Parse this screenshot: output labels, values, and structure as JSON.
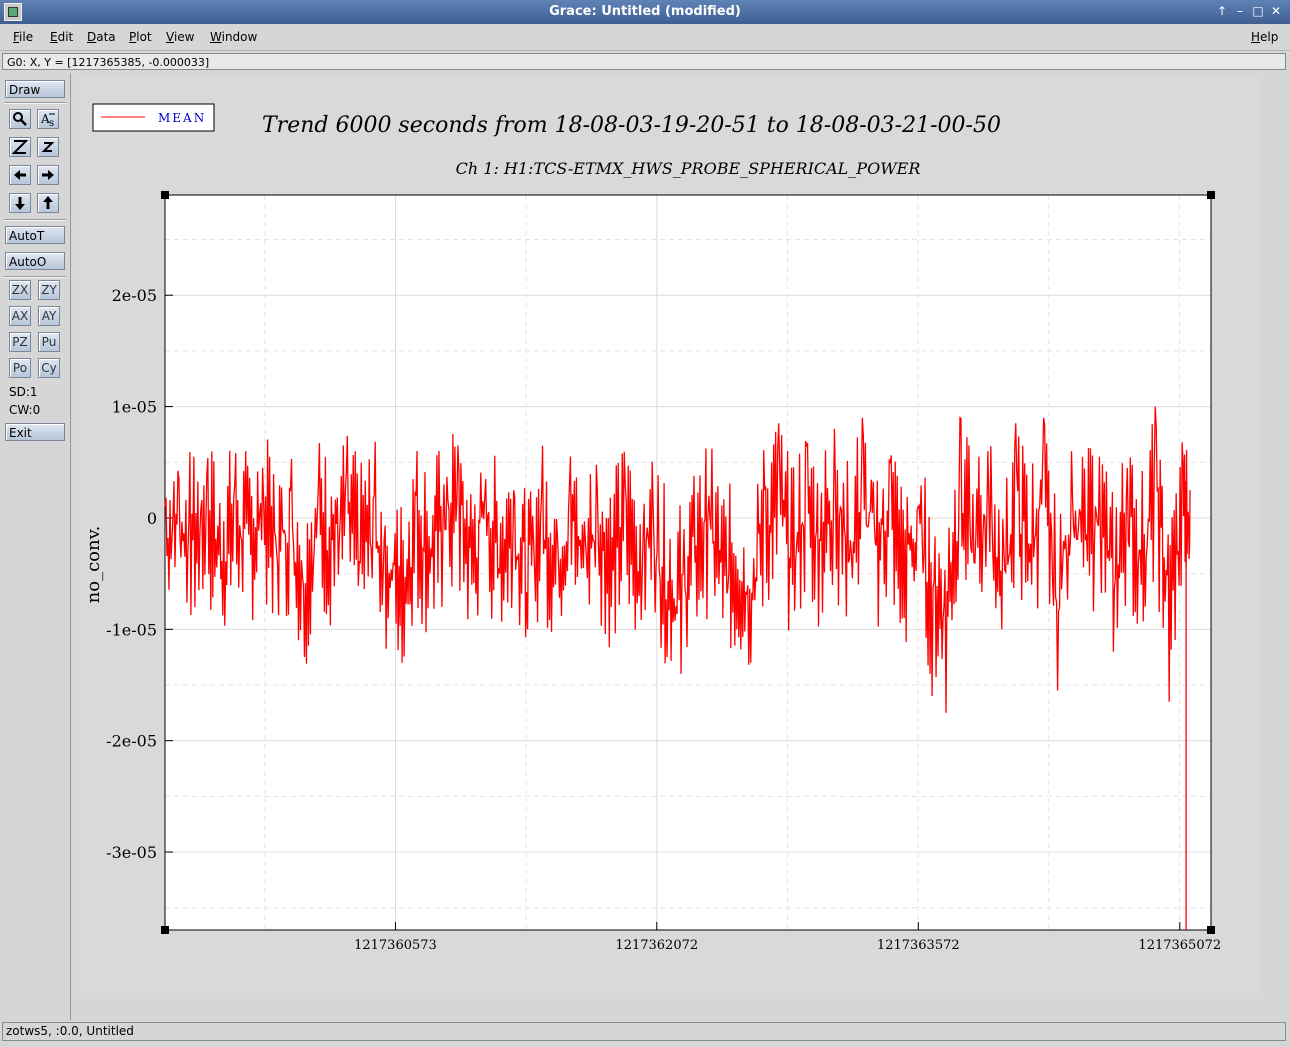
{
  "window": {
    "title": "Grace: Untitled (modified)"
  },
  "menubar": {
    "items": [
      {
        "label": "File",
        "u": "F",
        "rest": "ile"
      },
      {
        "label": "Edit",
        "u": "E",
        "rest": "dit"
      },
      {
        "label": "Data",
        "u": "D",
        "rest": "ata"
      },
      {
        "label": "Plot",
        "u": "P",
        "rest": "lot"
      },
      {
        "label": "View",
        "u": "V",
        "rest": "iew"
      },
      {
        "label": "Window",
        "u": "W",
        "rest": "indow"
      }
    ],
    "help": {
      "label": "Help",
      "u": "H",
      "rest": "elp"
    }
  },
  "locator": "G0: X, Y = [1217365385, -0.000033]",
  "toolbar": {
    "draw": "Draw",
    "autoT": "AutoT",
    "autoO": "AutoO",
    "zx": "ZX",
    "zy": "ZY",
    "ax": "AX",
    "ay": "AY",
    "pz": "PZ",
    "pu": "Pu",
    "po": "Po",
    "cy": "Cy",
    "sd": "SD:1",
    "cw": "CW:0",
    "exit": "Exit"
  },
  "status": "zotws5, :0.0, Untitled",
  "icons": [
    "zoom-icon",
    "autoscale-text-icon",
    "zoom-in-icon",
    "zoom-out-icon",
    "arrow-left-icon",
    "arrow-right-icon",
    "arrow-down-icon",
    "arrow-up-icon"
  ],
  "chart_data": {
    "type": "line",
    "title": "Trend 6000 seconds from 18-08-03-19-20-51 to 18-08-03-21-00-50",
    "subtitle": "Ch 1: H1:TCS-ETMX_HWS_PROBE_SPHERICAL_POWER",
    "xlabel": "",
    "ylabel": "no_conv.",
    "xlim": [
      1217359251,
      1217365251
    ],
    "ylim": [
      -3.7e-05,
      2.9e-05
    ],
    "xticks": [
      1217360573,
      1217362072,
      1217363572,
      1217365072
    ],
    "xtick_labels": [
      "1217360573",
      "1217362072",
      "1217363572",
      "1217365072"
    ],
    "yticks": [
      -3e-05,
      -2e-05,
      -1e-05,
      0,
      1e-05,
      2e-05
    ],
    "ytick_labels": [
      "-3e-05",
      "-2e-05",
      "-1e-05",
      "0",
      "1e-05",
      "2e-05"
    ],
    "grid": true,
    "legend_position": "top-left",
    "series": [
      {
        "name": "MEAN",
        "color": "#ff0000",
        "x": [
          1217359251,
          1217359331,
          1217359411,
          1217359491,
          1217359571,
          1217359651,
          1217359731,
          1217359811,
          1217359891,
          1217359971,
          1217360051,
          1217360131,
          1217360211,
          1217360291,
          1217360371,
          1217360451,
          1217360531,
          1217360611,
          1217360691,
          1217360771,
          1217360851,
          1217360931,
          1217361011,
          1217361091,
          1217361171,
          1217361251,
          1217361331,
          1217361411,
          1217361491,
          1217361571,
          1217361651,
          1217361731,
          1217361811,
          1217361891,
          1217361971,
          1217362051,
          1217362131,
          1217362211,
          1217362291,
          1217362371,
          1217362451,
          1217362531,
          1217362611,
          1217362691,
          1217362771,
          1217362851,
          1217362931,
          1217363011,
          1217363091,
          1217363171,
          1217363251,
          1217363331,
          1217363411,
          1217363491,
          1217363571,
          1217363651,
          1217363731,
          1217363811,
          1217363891,
          1217363971,
          1217364051,
          1217364131,
          1217364211,
          1217364291,
          1217364371,
          1217364451,
          1217364531,
          1217364611,
          1217364691,
          1217364771,
          1217364851,
          1217364931,
          1217365011,
          1217365091,
          1217365131
        ],
        "y": [
          1e-06,
          3.5e-06,
          -2e-06,
          4e-06,
          -5.5e-06,
          3e-06,
          -1.5e-06,
          4.5e-06,
          -3e-06,
          2.5e-06,
          -1.25e-05,
          3e-06,
          -2e-06,
          4e-06,
          -4e-06,
          2e-06,
          -9e-06,
          -1.3e-05,
          2e-06,
          -5e-06,
          3e-06,
          6.5e-06,
          -6e-06,
          3.5e-06,
          -5e-06,
          2.5e-06,
          -1e-05,
          2e-06,
          -6e-06,
          3e-06,
          -4.5e-06,
          2.5e-06,
          -8e-06,
          3e-06,
          -7e-06,
          1e-06,
          -1.25e-05,
          -1.4e-05,
          -4e-06,
          2e-06,
          -9e-06,
          -1e-05,
          -1.3e-05,
          2.5e-06,
          8.5e-06,
          -6e-06,
          6.5e-06,
          -2e-06,
          8e-06,
          -4e-06,
          9e-06,
          -2.5e-06,
          5e-06,
          -9e-06,
          1e-06,
          -1.6e-05,
          -1.75e-05,
          9e-06,
          -4e-06,
          6e-06,
          -1e-05,
          8.5e-06,
          -4e-06,
          9e-06,
          -1.55e-05,
          6e-06,
          -2e-06,
          5.5e-06,
          -1.2e-05,
          4.5e-06,
          -6e-06,
          1e-05,
          -1.65e-05,
          5e-06,
          2.5e-06
        ]
      }
    ]
  }
}
